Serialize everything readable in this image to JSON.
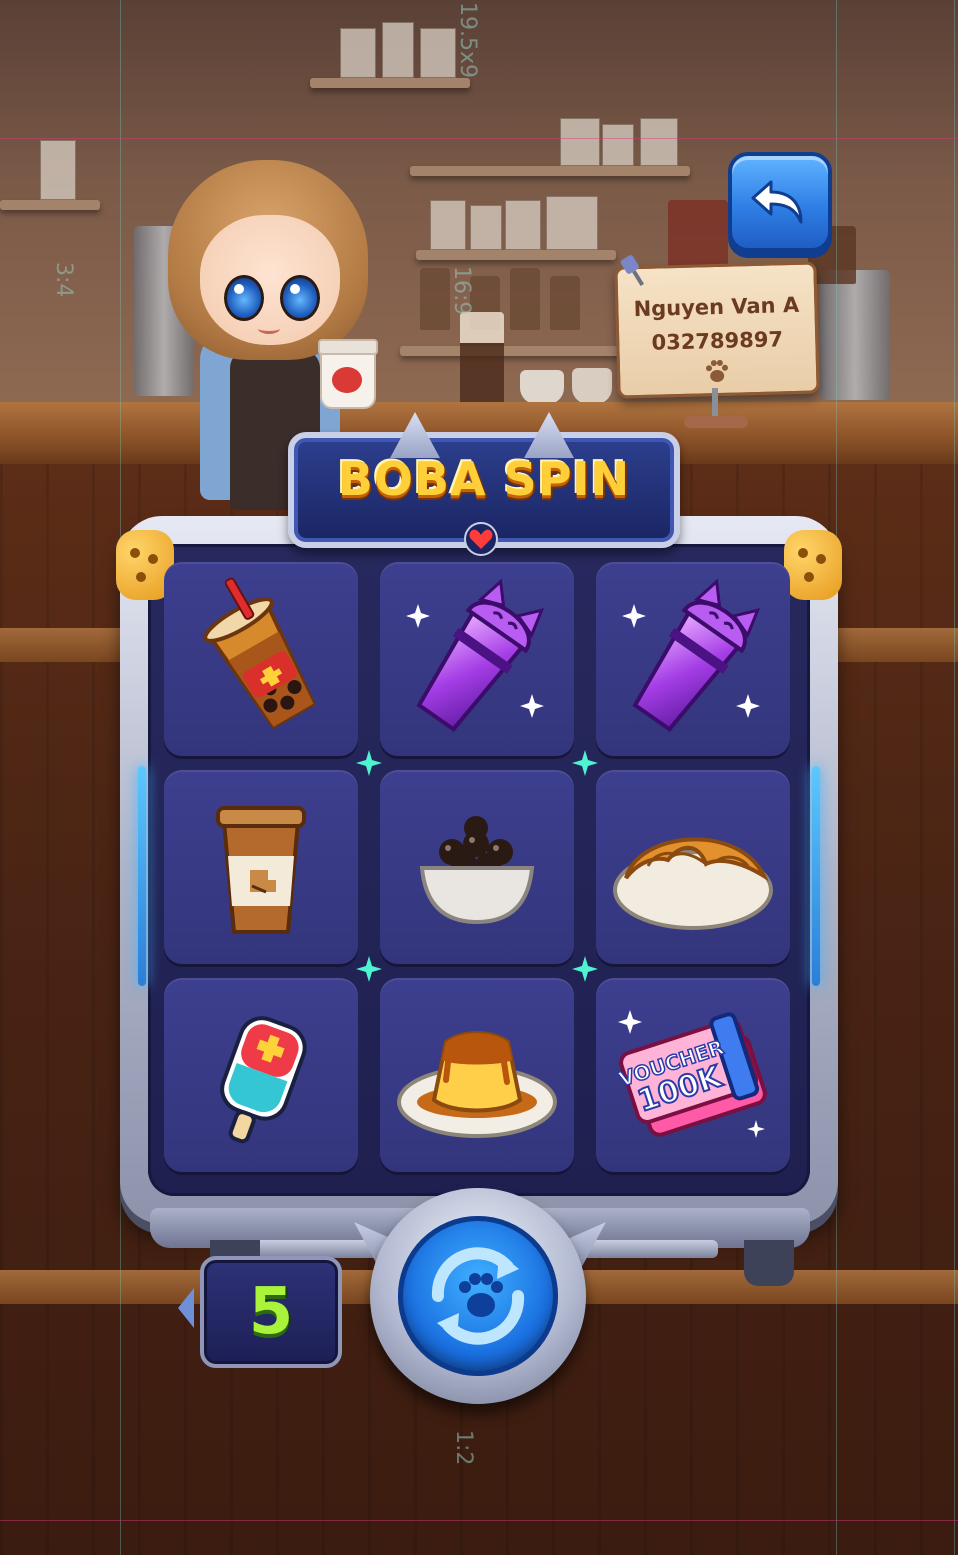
{
  "game": {
    "title": "BOBA SPIN"
  },
  "guides": {
    "top_label": "19.5x9",
    "left_label": "3:4",
    "mid_label": "16:9",
    "bottom_label": "1:2"
  },
  "player_sign": {
    "name": "Nguyen Van A",
    "phone": "032789897",
    "icon": "paw-icon"
  },
  "back_button": {
    "icon": "undo-arrow-icon"
  },
  "slot_grid": {
    "rows": [
      [
        {
          "item": "bubble-tea",
          "icon": "bubble-tea-icon"
        },
        {
          "item": "purple-cat-cup",
          "icon": "purple-cat-cup-icon"
        },
        {
          "item": "purple-cat-cup",
          "icon": "purple-cat-cup-icon"
        }
      ],
      [
        {
          "item": "coffee-cup",
          "icon": "coffee-cup-icon"
        },
        {
          "item": "tapioca-pearls",
          "icon": "tapioca-bowl-icon"
        },
        {
          "item": "croissant",
          "icon": "croissant-icon"
        }
      ],
      [
        {
          "item": "popsicle",
          "icon": "popsicle-icon"
        },
        {
          "item": "flan",
          "icon": "flan-icon"
        },
        {
          "item": "voucher",
          "icon": "voucher-ticket-icon",
          "line1": "VOUCHER",
          "line2": "100K"
        }
      ]
    ]
  },
  "spins_left": "5",
  "spin_button": {
    "icon": "paw-refresh-icon"
  },
  "colors": {
    "accent_gold": "#ffcf3a",
    "panel_navy": "#27295e",
    "spin_blue": "#1a6fe0",
    "counter_green": "#a9f43a"
  }
}
